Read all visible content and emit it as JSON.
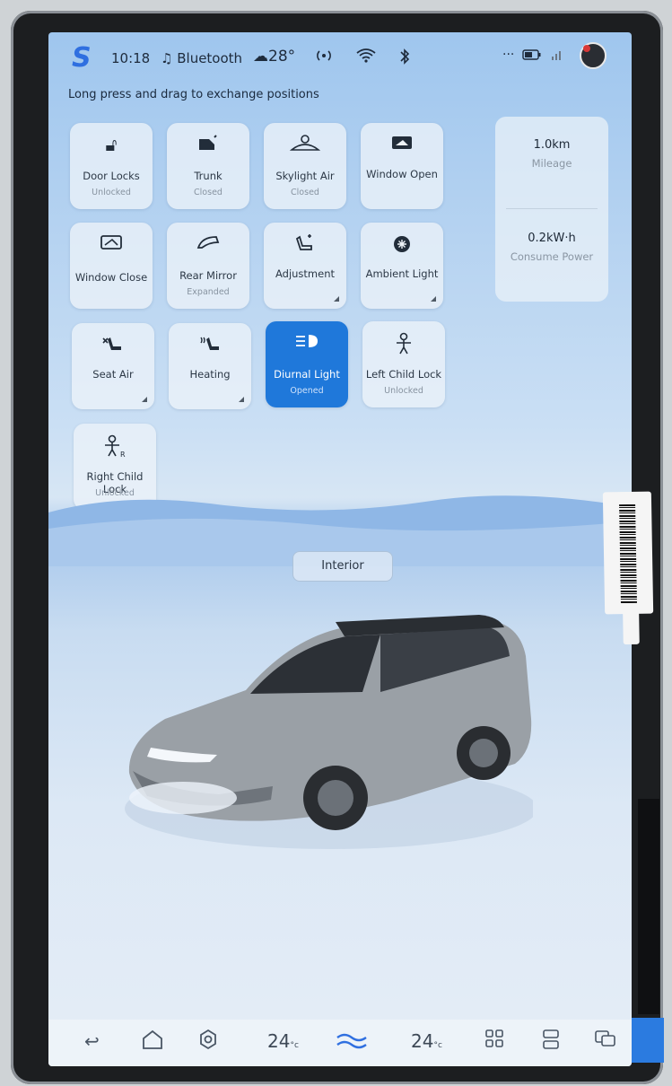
{
  "status_bar": {
    "time": "10:18",
    "bluetooth_label": "Bluetooth",
    "weather_temp": "28°"
  },
  "hint": "Long press and drag to exchange positions",
  "tiles": [
    {
      "label": "Door Locks",
      "status": "Unlocked",
      "icon": "lock-icon"
    },
    {
      "label": "Trunk",
      "status": "Closed",
      "icon": "trunk-icon"
    },
    {
      "label": "Skylight Air",
      "status": "Closed",
      "icon": "skylight-icon"
    },
    {
      "label": "Window Open",
      "status": "",
      "icon": "window-open-icon"
    },
    {
      "label": "Window Close",
      "status": "",
      "icon": "window-close-icon"
    },
    {
      "label": "Rear Mirror",
      "status": "Expanded",
      "icon": "mirror-icon"
    },
    {
      "label": "Adjustment",
      "status": "",
      "icon": "seat-adjust-icon"
    },
    {
      "label": "Ambient Light",
      "status": "",
      "icon": "ambient-light-icon"
    },
    {
      "label": "Seat Air",
      "status": "",
      "icon": "seat-air-icon"
    },
    {
      "label": "Heating",
      "status": "",
      "icon": "seat-heating-icon"
    },
    {
      "label": "Diurnal Light",
      "status": "Opened",
      "icon": "diurnal-light-icon",
      "active": true
    },
    {
      "label": "Left Child Lock",
      "status": "Unlocked",
      "icon": "child-lock-icon"
    },
    {
      "label": "Right Child Lock",
      "status": "Unlocked",
      "icon": "child-lock-icon"
    }
  ],
  "stats": {
    "mileage_value": "1.0km",
    "mileage_label": "Mileage",
    "power_value": "0.2kW·h",
    "power_label": "Consume Power"
  },
  "interior_button": "Interior",
  "dock": {
    "temp_left": "24",
    "temp_right": "24",
    "temp_unit": "°c"
  },
  "colors": {
    "active_tile": "#1f78da",
    "accent": "#2f6fe0"
  }
}
